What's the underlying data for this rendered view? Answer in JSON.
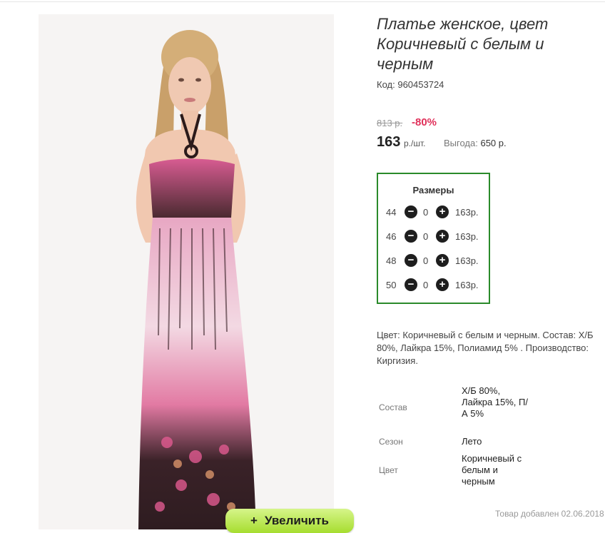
{
  "product": {
    "title": "Платье женское, цвет Коричневый с белым и черным",
    "code_label": "Код:",
    "code_value": "960453724",
    "old_price": "813 р.",
    "discount": "-80%",
    "price": "163",
    "price_unit": "р./шт.",
    "benefit_label": "Выгода:",
    "benefit_value": "650 р."
  },
  "sizes": {
    "header": "Размеры",
    "items": [
      {
        "size": "44",
        "qty": "0",
        "price": "163р."
      },
      {
        "size": "46",
        "qty": "0",
        "price": "163р."
      },
      {
        "size": "48",
        "qty": "0",
        "price": "163р."
      },
      {
        "size": "50",
        "qty": "0",
        "price": "163р."
      }
    ],
    "minus_glyph": "−",
    "plus_glyph": "+"
  },
  "description": "Цвет: Коричневый с белым и черным. Состав: Х/Б 80%, Лайкра 15%, Полиамид 5% . Производство: Киргизия.",
  "attributes": [
    {
      "label": "Состав",
      "value": "Х/Б 80%, Лайкра 15%, П/А 5%"
    },
    {
      "label": "Сезон",
      "value": "Лето"
    },
    {
      "label": "Цвет",
      "value": "Коричневый с белым и черным"
    }
  ],
  "zoom_button": {
    "icon": "plus-icon",
    "glyph": "+",
    "label": "Увеличить"
  },
  "added_text": "Товар добавлен 02.06.2018",
  "colors": {
    "accent_green": "#2a8a2a",
    "discount_red": "#e0305a",
    "button_green": "#a6dd2f"
  }
}
